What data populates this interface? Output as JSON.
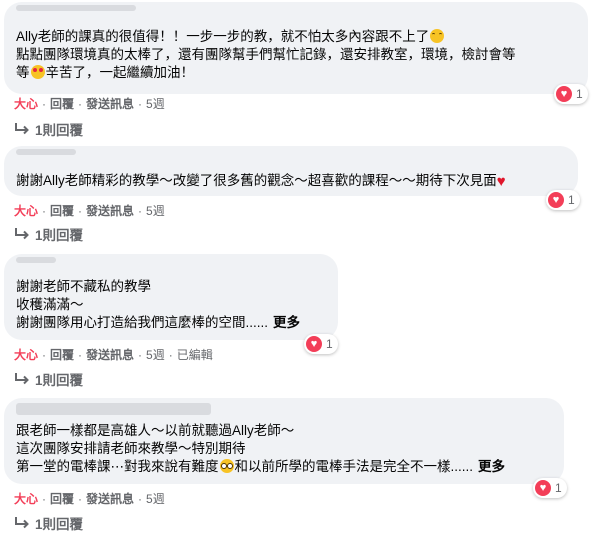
{
  "comments": [
    {
      "lines": [
        [
          "Ally老師的課真的很值得！！一步一步的教，就不怕太多內容跟不上了",
          "grinning-face-emoji"
        ],
        [
          "點點團隊環境真的太棒了，還有團隊幫手們幫忙記錄，還安排教室，環境，檢討會等"
        ],
        [
          "等",
          "heart-eyes-emoji",
          "辛苦了，一起繼續加油！"
        ]
      ],
      "reaction_count": "1",
      "actions": {
        "reaction": "大心",
        "reply": "回覆",
        "send": "發送訊息",
        "time": "5週"
      },
      "replies": "1則回覆"
    },
    {
      "lines": [
        [
          "謝謝Ally老師精彩的教學～改變了很多舊的觀念～超喜歡的課程～～期待下次見面",
          "red-heart-emoji"
        ]
      ],
      "reaction_count": "1",
      "actions": {
        "reaction": "大心",
        "reply": "回覆",
        "send": "發送訊息",
        "time": "5週"
      },
      "replies": "1則回覆"
    },
    {
      "lines": [
        [
          "謝謝老師不藏私的教學"
        ],
        [
          "收穫滿滿～"
        ],
        [
          "謝謝團隊用心打造給我們這麼棒的空間......"
        ]
      ],
      "more": "更多",
      "reaction_count": "1",
      "actions": {
        "reaction": "大心",
        "reply": "回覆",
        "send": "發送訊息",
        "time": "5週",
        "edited": "已編輯"
      },
      "replies": "1則回覆"
    },
    {
      "lines": [
        [
          "跟老師一樣都是高雄人～以前就聽過Ally老師～"
        ],
        [
          "這次團隊安排請老師來教學～特別期待"
        ],
        [
          "第一堂的電棒課⋯對我來說有難度",
          "pleading-face-emoji",
          "和以前所學的電棒手法是完全不一樣......"
        ]
      ],
      "more": "更多",
      "reaction_count": "1",
      "actions": {
        "reaction": "大心",
        "reply": "回覆",
        "send": "發送訊息",
        "time": "5週"
      },
      "replies": "1則回覆"
    }
  ],
  "colors": {
    "bubble": "#f0f2f5",
    "love": "#f33e58",
    "meta": "#65676b"
  }
}
